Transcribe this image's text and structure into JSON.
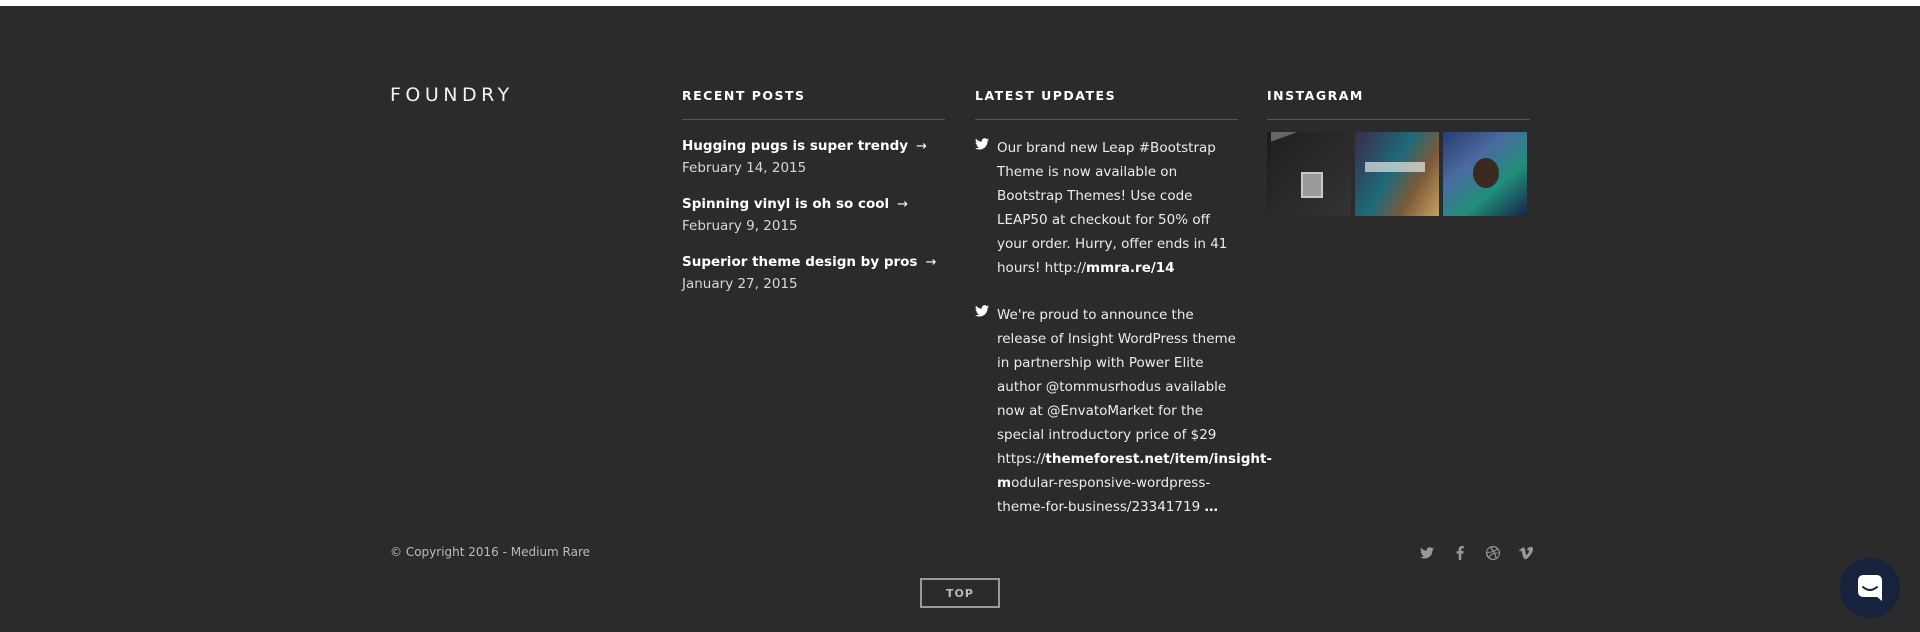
{
  "brand": {
    "logo": "FOUNDRY"
  },
  "recent_posts": {
    "heading": "RECENT POSTS",
    "items": [
      {
        "title": "Hugging pugs is super trendy",
        "date": "February 14, 2015"
      },
      {
        "title": "Spinning vinyl is oh so cool",
        "date": "February 9, 2015"
      },
      {
        "title": "Superior theme design by pros",
        "date": "January 27, 2015"
      }
    ],
    "arrow_icon": "arrow-right-icon"
  },
  "latest_updates": {
    "heading": "LATEST UPDATES",
    "tweets": [
      {
        "text": "Our brand new Leap #Bootstrap Theme is now available on Bootstrap Themes! Use code LEAP50 at checkout for 50% off your order. Hurry, offer ends in 41 hours! http://",
        "link": "mmra.re/14"
      },
      {
        "text": "We're proud to announce the release of Insight WordPress theme in partnership with Power Elite author @tommusrhodus available now at @EnvatoMarket for the special introductory price of $29 https://",
        "link": "themeforest.net/item/insight-m",
        "text_after": "odular-responsive-wordpress-theme-for-business/23341719",
        "ellipsis": "…"
      }
    ],
    "icon": "twitter-icon"
  },
  "instagram": {
    "heading": "INSTAGRAM",
    "thumbnails": [
      "instagram-photo-1",
      "instagram-photo-2",
      "instagram-photo-3"
    ]
  },
  "bottom": {
    "copyright": "© Copyright 2016 - Medium Rare",
    "social_icons": [
      "twitter-icon",
      "facebook-icon",
      "dribbble-icon",
      "vimeo-icon"
    ],
    "top_button": "TOP"
  },
  "colors": {
    "footer_bg": "#2b2b2b",
    "chat_bg": "#17233d"
  }
}
